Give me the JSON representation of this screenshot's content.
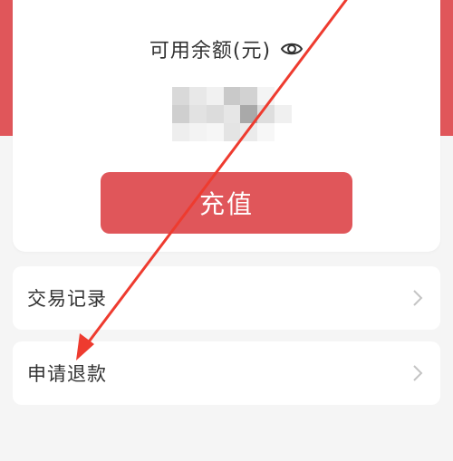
{
  "balance": {
    "label": "可用余额(元)",
    "value_hidden": true
  },
  "recharge_button": {
    "label": "充值"
  },
  "menu": {
    "items": [
      {
        "label": "交易记录"
      },
      {
        "label": "申请退款"
      }
    ]
  },
  "colors": {
    "accent": "#e0565a",
    "text": "#333333",
    "background": "#f5f5f5",
    "annotation_arrow": "#ee3b2f"
  },
  "icons": {
    "visibility": "eye-icon",
    "chevron": "chevron-right-icon"
  }
}
